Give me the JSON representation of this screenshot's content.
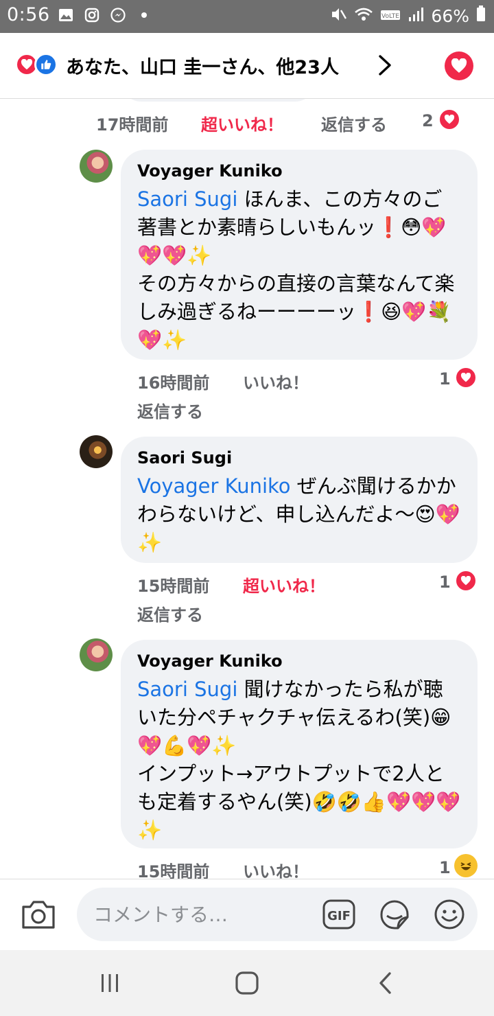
{
  "status_bar": {
    "time": "0:56",
    "battery": "66%"
  },
  "header": {
    "reaction_summary": "あなた、山口 圭一さん、他23人"
  },
  "top_row": {
    "time": "17時間前",
    "reaction_label": "超いいね！",
    "reply_label": "返信する",
    "reaction_count": "2"
  },
  "comments": [
    {
      "author": "Voyager Kuniko",
      "mention": "Saori Sugi",
      "text": " ほんま、この方々のご著書とか素晴らしいもんッ❗😳💖💖💖✨\nその方々からの直接の言葉なんて楽しみ過ぎるねーーーーッ❗😆💖💐💖✨",
      "time": "16時間前",
      "like_label": "いいね！",
      "reply_label": "返信する",
      "reaction_count": "1",
      "reaction": "heart"
    },
    {
      "author": "Saori Sugi",
      "mention": "Voyager Kuniko",
      "text": " ぜんぶ聞けるかかわらないけど、申し込んだよ〜😍💖✨",
      "time": "15時間前",
      "like_label": "超いいね！",
      "reply_label": "返信する",
      "reaction_count": "1",
      "reaction": "heart"
    },
    {
      "author": "Voyager Kuniko",
      "mention": "Saori Sugi",
      "text": " 聞けなかったら私が聴いた分ペチャクチャ伝えるわ(笑)😁💖💪💖✨\nインプット→アウトプットで2人とも定着するやん(笑)🤣🤣👍💖💖💖✨",
      "time": "15時間前",
      "like_label": "いいね！",
      "reaction_count": "1",
      "reaction": "haha"
    }
  ],
  "composer": {
    "placeholder": "コメントする…"
  },
  "icons": {
    "camera": "camera-icon",
    "gif": "gif-icon",
    "sticker": "sticker-icon",
    "emoji": "emoji-icon",
    "love": "love-reaction-icon",
    "like": "like-reaction-icon"
  },
  "colors": {
    "love": "#f0284a",
    "like": "#1b74e4",
    "mention": "#1b74e4",
    "bubble": "#f0f2f5",
    "meta": "#65676b"
  }
}
